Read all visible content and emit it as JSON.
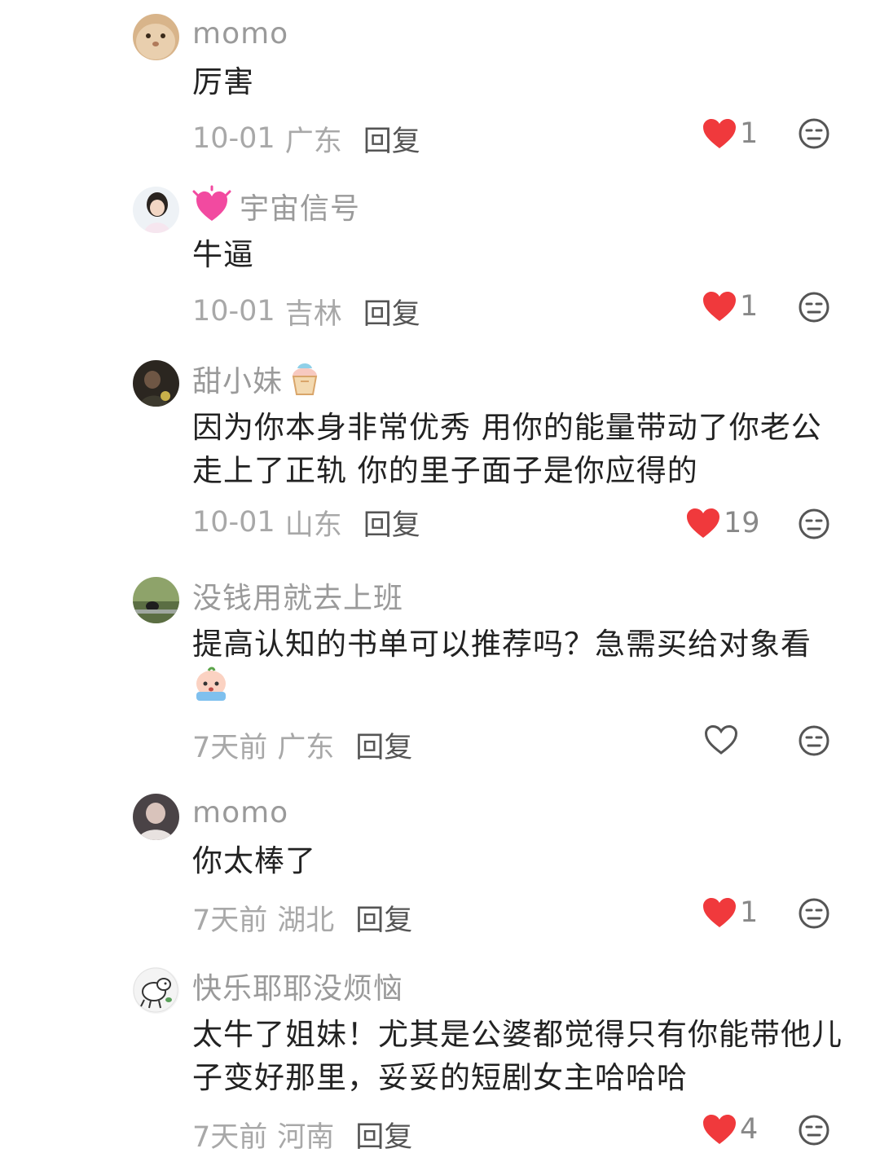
{
  "colors": {
    "like_red": "#f0393c",
    "muted": "#9a9a9a",
    "text": "#222222"
  },
  "comments": [
    {
      "username": "momo",
      "text": "厉害",
      "time": "10-01",
      "location": "广东",
      "reply": "回复",
      "likes": "1",
      "liked": true,
      "avatar": "rabbit-avatar"
    },
    {
      "username": "宇宙信号",
      "name_prefix_icon": "heart-sparkle-icon",
      "text": "牛逼",
      "time": "10-01",
      "location": "吉林",
      "reply": "回复",
      "likes": "1",
      "liked": true,
      "avatar": "girl-avatar"
    },
    {
      "username": "甜小妹",
      "name_suffix_icon": "shaved-ice-icon",
      "text": "因为你本身非常优秀 用你的能量带动了你老公走上了正轨 你的里子面子是你应得的",
      "time": "10-01",
      "location": "山东",
      "reply": "回复",
      "likes": "19",
      "liked": true,
      "avatar": "dark-photo-avatar"
    },
    {
      "username": "没钱用就去上班",
      "text": "提高认知的书单可以推荐吗？急需买给对象看",
      "text_emoji": "crying-emoji-icon",
      "time": "7天前",
      "location": "广东",
      "reply": "回复",
      "likes": "",
      "liked": false,
      "avatar": "landscape-avatar"
    },
    {
      "username": "momo",
      "text": "你太棒了",
      "time": "7天前",
      "location": "湖北",
      "reply": "回复",
      "likes": "1",
      "liked": true,
      "avatar": "portrait-avatar"
    },
    {
      "username": "快乐耶耶没烦恼",
      "text": "太牛了姐妹！尤其是公婆都觉得只有你能带他儿子变好那里，妥妥的短剧女主哈哈哈",
      "time": "7天前",
      "location": "河南",
      "reply": "回复",
      "likes": "4",
      "liked": true,
      "avatar": "cartoon-dog-avatar"
    }
  ]
}
